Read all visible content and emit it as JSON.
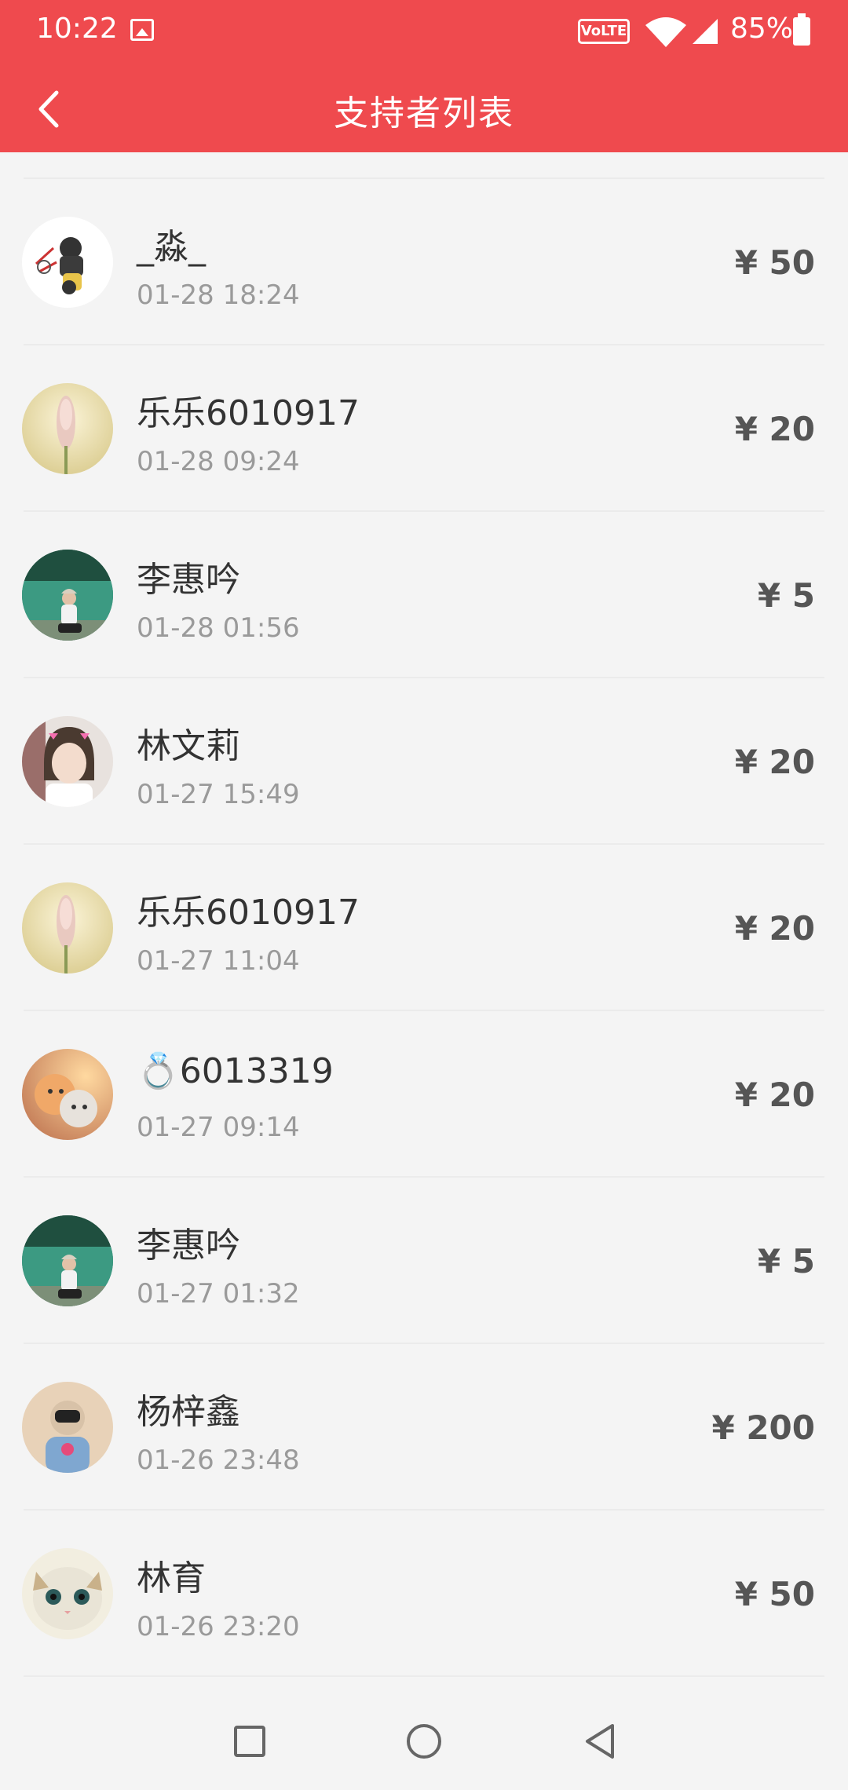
{
  "status_bar": {
    "time": "10:22",
    "network_badge": "VoLTE",
    "battery": "85%"
  },
  "header": {
    "title": "支持者列表",
    "back_icon": "chevron-left-icon",
    "background_color": "#ef4a4e"
  },
  "supporters": [
    {
      "name": "_淼_",
      "time": "01-28 18:24",
      "amount": "¥ 50",
      "avatar": "cartoon-avatar"
    },
    {
      "name": "乐乐6010917",
      "time": "01-28 09:24",
      "amount": "¥ 20",
      "avatar": "flower-avatar"
    },
    {
      "name": "李惠吟",
      "time": "01-28 01:56",
      "amount": "¥ 5",
      "avatar": "lake-photo-avatar"
    },
    {
      "name": "林文莉",
      "time": "01-27 15:49",
      "amount": "¥ 20",
      "avatar": "portrait-avatar"
    },
    {
      "name": "乐乐6010917",
      "time": "01-27 11:04",
      "amount": "¥ 20",
      "avatar": "flower-avatar"
    },
    {
      "name": "💍6013319",
      "time": "01-27 09:14",
      "amount": "¥ 20",
      "avatar": "kittens-avatar"
    },
    {
      "name": "李惠吟",
      "time": "01-27 01:32",
      "amount": "¥ 5",
      "avatar": "lake-photo-avatar"
    },
    {
      "name": "杨梓鑫",
      "time": "01-26 23:48",
      "amount": "¥ 200",
      "avatar": "child-photo-avatar"
    },
    {
      "name": "林育",
      "time": "01-26 23:20",
      "amount": "¥ 50",
      "avatar": "cat-avatar"
    }
  ],
  "nav_bar": {
    "recent_icon": "square-icon",
    "home_icon": "circle-icon",
    "back_icon": "triangle-back-icon"
  }
}
